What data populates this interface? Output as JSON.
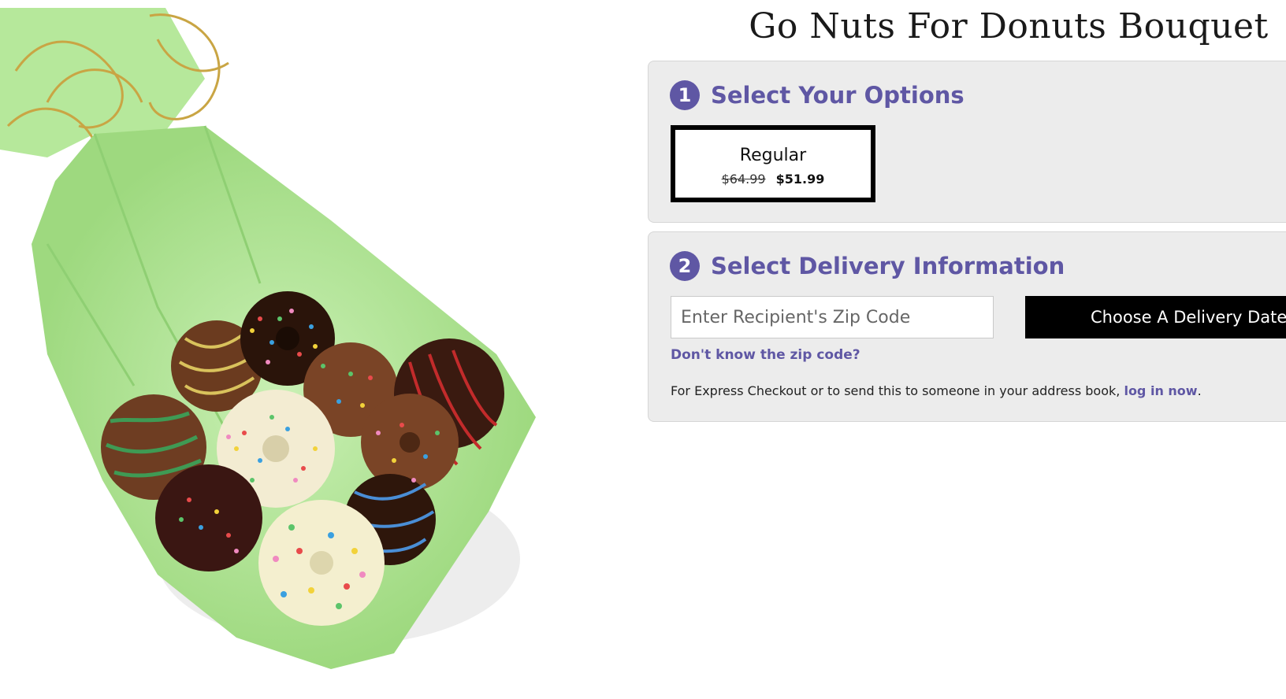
{
  "product": {
    "title": "Go Nuts For Donuts Bouquet",
    "image_alt": "donut bouquet wrapped in green tissue with gold ribbon"
  },
  "step1": {
    "number": "1",
    "title": "Select Your Options",
    "option": {
      "name": "Regular",
      "original_price": "$64.99",
      "sale_price": "$51.99",
      "selected": true
    }
  },
  "step2": {
    "number": "2",
    "title": "Select Delivery Information",
    "zip_placeholder": "Enter Recipient's Zip Code",
    "delivery_button": "Choose A Delivery Date »",
    "zip_help_link": "Don't know the zip code?",
    "express_text": "For Express Checkout or to send this to someone in your address book,",
    "login_link": "log in now",
    "express_suffix": "."
  },
  "colors": {
    "accent": "#5f57a4",
    "panel_bg": "#ececec",
    "button_bg": "#000000"
  }
}
